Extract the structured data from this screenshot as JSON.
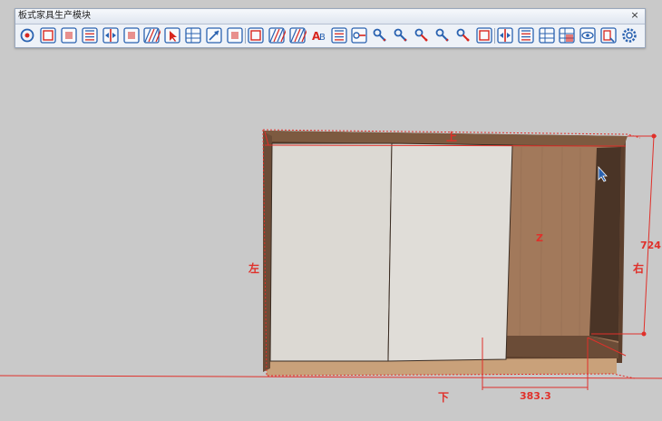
{
  "toolbar": {
    "title": "板式家具生产模块",
    "close_label": "×",
    "accent_color": "#2a62b0",
    "icon_color_red": "#d8261e",
    "tools": [
      {
        "name": "rotate-view-icon"
      },
      {
        "name": "component-frame-icon"
      },
      {
        "name": "add-board-icon"
      },
      {
        "name": "list-icon"
      },
      {
        "name": "split-board-icon"
      },
      {
        "name": "board-edit-icon"
      },
      {
        "name": "hatch-board-icon"
      },
      {
        "name": "select-cursor-icon"
      },
      {
        "name": "grid-table-icon"
      },
      {
        "name": "resize-arrow-icon"
      },
      {
        "name": "edge-band-icon"
      },
      {
        "name": "door-icon"
      },
      {
        "name": "texture-icon"
      },
      {
        "name": "material-map-icon"
      },
      {
        "name": "ab-label-icon"
      },
      {
        "name": "barcode-icon"
      },
      {
        "name": "drill-icon"
      },
      {
        "name": "key-blue-icon"
      },
      {
        "name": "key-pencil-icon"
      },
      {
        "name": "key-red-icon"
      },
      {
        "name": "key-arrow-icon"
      },
      {
        "name": "key-orange-icon"
      },
      {
        "name": "frame-square-icon"
      },
      {
        "name": "connector-icon"
      },
      {
        "name": "checklist-icon"
      },
      {
        "name": "table-icon"
      },
      {
        "name": "table-red-icon"
      },
      {
        "name": "eye-icon"
      },
      {
        "name": "export-icon"
      },
      {
        "name": "gear-icon"
      }
    ]
  },
  "model": {
    "label_top": "上",
    "label_bottom": "下",
    "label_left": "左",
    "label_right": "右",
    "center_mark": "Z",
    "height_dimension": "724",
    "width_dimension": "383.3",
    "dimension_color": "#e0302a",
    "door_color": "#dcd9d3",
    "wood_color": "#a2795b",
    "frame_color": "#5c3f2c",
    "floor_color": "#c8c8c8"
  }
}
